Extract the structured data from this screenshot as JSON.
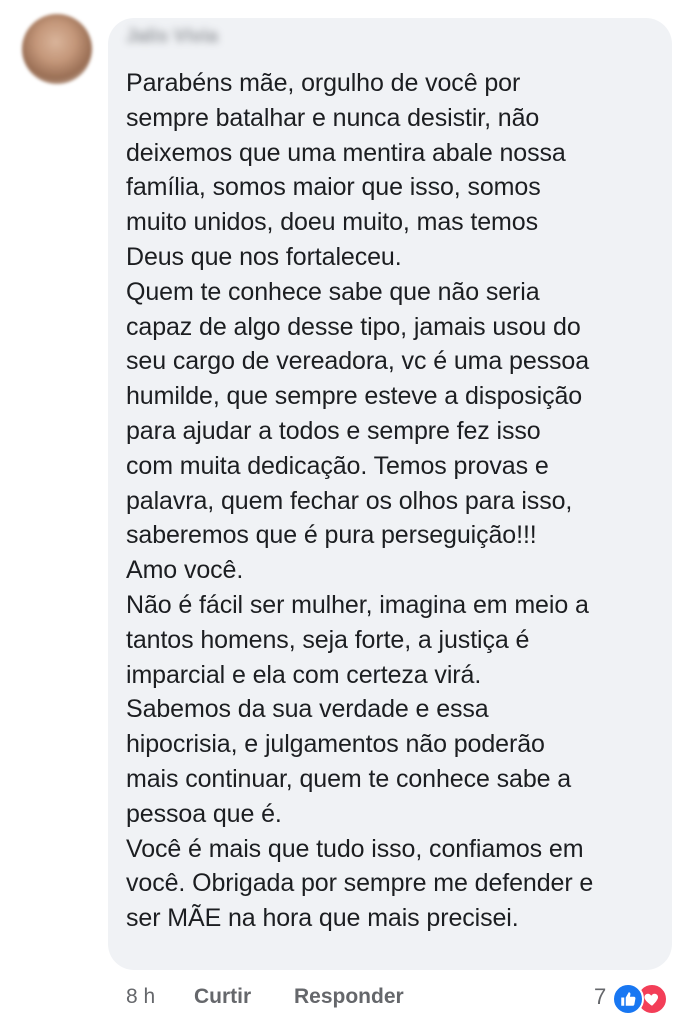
{
  "comment": {
    "author": "Jalis Vívia",
    "lines": [
      "Parabéns mãe, orgulho de você por",
      "sempre batalhar e nunca desistir, não",
      "deixemos que uma mentira abale nossa",
      "família, somos maior que isso, somos",
      "muito unidos, doeu muito, mas temos",
      "Deus que nos fortaleceu.",
      "Quem te conhece sabe que não seria",
      "capaz de algo desse tipo, jamais usou do",
      "seu cargo de vereadora, vc é uma pessoa",
      "humilde, que sempre esteve a disposição",
      "para ajudar a todos e sempre fez isso",
      "com muita dedicação. Temos provas e",
      "palavra, quem fechar os olhos para isso,",
      "saberemos que é pura perseguição!!!",
      "Amo você.",
      "Não é fácil ser mulher, imagina em meio a",
      "tantos homens, seja forte, a justiça é",
      "imparcial e ela com certeza virá.",
      "Sabemos da sua verdade e essa",
      "hipocrisia, e julgamentos não poderão",
      "mais continuar, quem te conhece sabe a",
      "pessoa que é.",
      "Você é mais que tudo isso, confiamos em",
      "você. Obrigada por sempre me defender e",
      "ser MÃE na hora que mais precisei."
    ]
  },
  "footer": {
    "time": "8 h",
    "like_label": "Curtir",
    "reply_label": "Responder"
  },
  "reactions": {
    "count": "7",
    "icons": [
      "like-icon",
      "love-icon"
    ],
    "like_color": "#1877f2",
    "love_color": "#f33e58"
  },
  "colors": {
    "bubble": "#f0f2f5",
    "text": "#1c1e21",
    "meta": "#65676b"
  }
}
